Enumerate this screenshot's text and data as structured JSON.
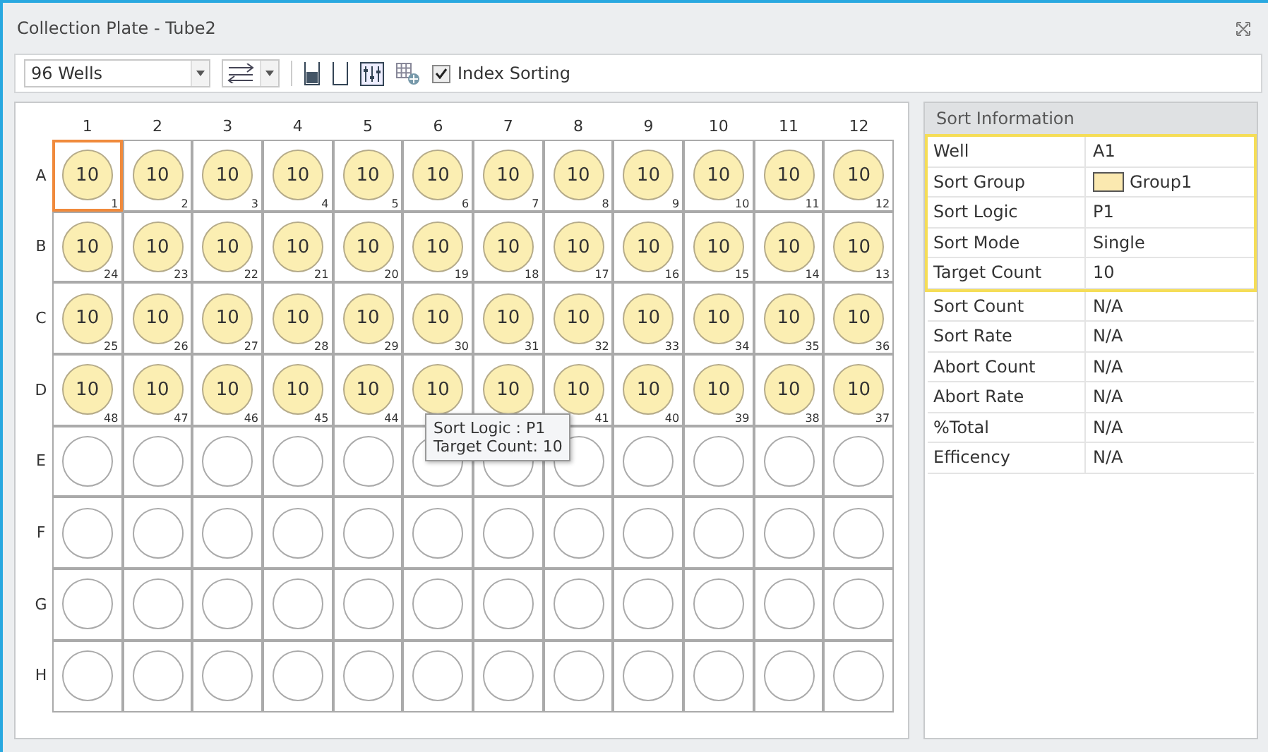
{
  "window": {
    "title": "Collection Plate - Tube2"
  },
  "toolbar": {
    "plate_type": "96 Wells",
    "index_sorting": {
      "label": "Index Sorting",
      "checked": true
    }
  },
  "plate": {
    "columns": [
      "1",
      "2",
      "3",
      "4",
      "5",
      "6",
      "7",
      "8",
      "9",
      "10",
      "11",
      "12"
    ],
    "rows": [
      {
        "label": "A",
        "wells": [
          {
            "filled": true,
            "selected": true,
            "count": "10",
            "index": "1"
          },
          {
            "filled": true,
            "selected": false,
            "count": "10",
            "index": "2"
          },
          {
            "filled": true,
            "selected": false,
            "count": "10",
            "index": "3"
          },
          {
            "filled": true,
            "selected": false,
            "count": "10",
            "index": "4"
          },
          {
            "filled": true,
            "selected": false,
            "count": "10",
            "index": "5"
          },
          {
            "filled": true,
            "selected": false,
            "count": "10",
            "index": "6"
          },
          {
            "filled": true,
            "selected": false,
            "count": "10",
            "index": "7"
          },
          {
            "filled": true,
            "selected": false,
            "count": "10",
            "index": "8"
          },
          {
            "filled": true,
            "selected": false,
            "count": "10",
            "index": "9"
          },
          {
            "filled": true,
            "selected": false,
            "count": "10",
            "index": "10"
          },
          {
            "filled": true,
            "selected": false,
            "count": "10",
            "index": "11"
          },
          {
            "filled": true,
            "selected": false,
            "count": "10",
            "index": "12"
          }
        ]
      },
      {
        "label": "B",
        "wells": [
          {
            "filled": true,
            "selected": false,
            "count": "10",
            "index": "24"
          },
          {
            "filled": true,
            "selected": false,
            "count": "10",
            "index": "23"
          },
          {
            "filled": true,
            "selected": false,
            "count": "10",
            "index": "22"
          },
          {
            "filled": true,
            "selected": false,
            "count": "10",
            "index": "21"
          },
          {
            "filled": true,
            "selected": false,
            "count": "10",
            "index": "20"
          },
          {
            "filled": true,
            "selected": false,
            "count": "10",
            "index": "19"
          },
          {
            "filled": true,
            "selected": false,
            "count": "10",
            "index": "18"
          },
          {
            "filled": true,
            "selected": false,
            "count": "10",
            "index": "17"
          },
          {
            "filled": true,
            "selected": false,
            "count": "10",
            "index": "16"
          },
          {
            "filled": true,
            "selected": false,
            "count": "10",
            "index": "15"
          },
          {
            "filled": true,
            "selected": false,
            "count": "10",
            "index": "14"
          },
          {
            "filled": true,
            "selected": false,
            "count": "10",
            "index": "13"
          }
        ]
      },
      {
        "label": "C",
        "wells": [
          {
            "filled": true,
            "selected": false,
            "count": "10",
            "index": "25"
          },
          {
            "filled": true,
            "selected": false,
            "count": "10",
            "index": "26"
          },
          {
            "filled": true,
            "selected": false,
            "count": "10",
            "index": "27"
          },
          {
            "filled": true,
            "selected": false,
            "count": "10",
            "index": "28"
          },
          {
            "filled": true,
            "selected": false,
            "count": "10",
            "index": "29"
          },
          {
            "filled": true,
            "selected": false,
            "count": "10",
            "index": "30"
          },
          {
            "filled": true,
            "selected": false,
            "count": "10",
            "index": "31"
          },
          {
            "filled": true,
            "selected": false,
            "count": "10",
            "index": "32"
          },
          {
            "filled": true,
            "selected": false,
            "count": "10",
            "index": "33"
          },
          {
            "filled": true,
            "selected": false,
            "count": "10",
            "index": "34"
          },
          {
            "filled": true,
            "selected": false,
            "count": "10",
            "index": "35"
          },
          {
            "filled": true,
            "selected": false,
            "count": "10",
            "index": "36"
          }
        ]
      },
      {
        "label": "D",
        "wells": [
          {
            "filled": true,
            "selected": false,
            "count": "10",
            "index": "48"
          },
          {
            "filled": true,
            "selected": false,
            "count": "10",
            "index": "47"
          },
          {
            "filled": true,
            "selected": false,
            "count": "10",
            "index": "46"
          },
          {
            "filled": true,
            "selected": false,
            "count": "10",
            "index": "45"
          },
          {
            "filled": true,
            "selected": false,
            "count": "10",
            "index": "44"
          },
          {
            "filled": true,
            "selected": false,
            "count": "10"
          },
          {
            "filled": true,
            "selected": false,
            "count": "10"
          },
          {
            "filled": true,
            "selected": false,
            "count": "10",
            "index": "41"
          },
          {
            "filled": true,
            "selected": false,
            "count": "10",
            "index": "40"
          },
          {
            "filled": true,
            "selected": false,
            "count": "10",
            "index": "39"
          },
          {
            "filled": true,
            "selected": false,
            "count": "10",
            "index": "38"
          },
          {
            "filled": true,
            "selected": false,
            "count": "10",
            "index": "37"
          }
        ]
      },
      {
        "label": "E",
        "wells": [
          {
            "filled": false,
            "selected": false
          },
          {
            "filled": false,
            "selected": false
          },
          {
            "filled": false,
            "selected": false
          },
          {
            "filled": false,
            "selected": false
          },
          {
            "filled": false,
            "selected": false
          },
          {
            "filled": false,
            "selected": false
          },
          {
            "filled": false,
            "selected": false
          },
          {
            "filled": false,
            "selected": false
          },
          {
            "filled": false,
            "selected": false
          },
          {
            "filled": false,
            "selected": false
          },
          {
            "filled": false,
            "selected": false
          },
          {
            "filled": false,
            "selected": false
          }
        ]
      },
      {
        "label": "F",
        "wells": [
          {
            "filled": false,
            "selected": false
          },
          {
            "filled": false,
            "selected": false
          },
          {
            "filled": false,
            "selected": false
          },
          {
            "filled": false,
            "selected": false
          },
          {
            "filled": false,
            "selected": false
          },
          {
            "filled": false,
            "selected": false
          },
          {
            "filled": false,
            "selected": false
          },
          {
            "filled": false,
            "selected": false
          },
          {
            "filled": false,
            "selected": false
          },
          {
            "filled": false,
            "selected": false
          },
          {
            "filled": false,
            "selected": false
          },
          {
            "filled": false,
            "selected": false
          }
        ]
      },
      {
        "label": "G",
        "wells": [
          {
            "filled": false,
            "selected": false
          },
          {
            "filled": false,
            "selected": false
          },
          {
            "filled": false,
            "selected": false
          },
          {
            "filled": false,
            "selected": false
          },
          {
            "filled": false,
            "selected": false
          },
          {
            "filled": false,
            "selected": false
          },
          {
            "filled": false,
            "selected": false
          },
          {
            "filled": false,
            "selected": false
          },
          {
            "filled": false,
            "selected": false
          },
          {
            "filled": false,
            "selected": false
          },
          {
            "filled": false,
            "selected": false
          },
          {
            "filled": false,
            "selected": false
          }
        ]
      },
      {
        "label": "H",
        "wells": [
          {
            "filled": false,
            "selected": false
          },
          {
            "filled": false,
            "selected": false
          },
          {
            "filled": false,
            "selected": false
          },
          {
            "filled": false,
            "selected": false
          },
          {
            "filled": false,
            "selected": false
          },
          {
            "filled": false,
            "selected": false
          },
          {
            "filled": false,
            "selected": false
          },
          {
            "filled": false,
            "selected": false
          },
          {
            "filled": false,
            "selected": false
          },
          {
            "filled": false,
            "selected": false
          },
          {
            "filled": false,
            "selected": false
          },
          {
            "filled": false,
            "selected": false
          }
        ]
      }
    ],
    "tooltip": [
      "Sort Logic : P1",
      "Target Count: 10"
    ]
  },
  "sort_information": {
    "title": "Sort Information",
    "rows": [
      {
        "label": "Well",
        "value": "A1",
        "highlighted": true
      },
      {
        "label": "Sort Group",
        "value": "Group1",
        "color": "#fbe9b0",
        "highlighted": true
      },
      {
        "label": "Sort Logic",
        "value": "P1",
        "highlighted": true
      },
      {
        "label": "Sort Mode",
        "value": "Single",
        "highlighted": true
      },
      {
        "label": "Target Count",
        "value": "10",
        "highlighted": true
      },
      {
        "label": "Sort Count",
        "value": "N/A",
        "highlighted": false
      },
      {
        "label": "Sort Rate",
        "value": "N/A",
        "highlighted": false
      },
      {
        "label": "Abort Count",
        "value": "N/A",
        "highlighted": false
      },
      {
        "label": "Abort Rate",
        "value": "N/A",
        "highlighted": false
      },
      {
        "label": "%Total",
        "value": "N/A",
        "highlighted": false
      },
      {
        "label": "Efficency",
        "value": "N/A",
        "highlighted": false
      }
    ]
  }
}
